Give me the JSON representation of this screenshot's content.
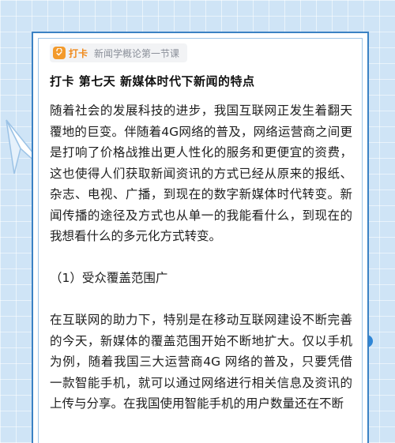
{
  "tag": {
    "name": "打卡",
    "course": "新闻学概论第一节课",
    "icon": "checkin-bag-icon",
    "accent": "#f39a2b"
  },
  "title": "打卡 第七天 新媒体时代下新闻的特点",
  "paragraphs": [
    "随着社会的发展科技的进步，我国互联网正发生着翻天覆地的巨变。伴随着4G网络的普及，网络运营商之间更是打响了价格战推出更人性化的服务和更便宜的资费，这也使得人们获取新闻资讯的方式已经从原来的报纸、杂志、电视、广播，到现在的数字新媒体时代转变。新闻传播的途径及方式也从单一的我能看什么，到现在的我想看什么的多元化方式转变。",
    "（1）受众覆盖范围广",
    "在互联网的助力下，特别是在移动互联网建设不断完善的今天，新媒体的覆盖范围开始不断地扩大。仅以手机为例，随着我国三大运营商4G 网络的普及，只要凭借一款智能手机，就可以通过网络进行相关信息及资讯的上传与分享。在我国使用智能手机的用户数量还在不断"
  ],
  "colors": {
    "background": "#cfe4f6",
    "frame": "#3b82c4",
    "decor": "#2f86d6"
  }
}
